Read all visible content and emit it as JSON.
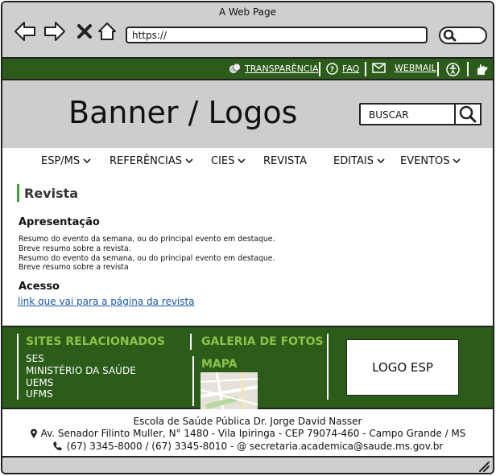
{
  "browser": {
    "title": "A Web Page",
    "url": "https://"
  },
  "utility": {
    "transparencia": "TRANSPARÊNCIA",
    "faq": "FAQ",
    "webmail": "WEBMAIL"
  },
  "banner": {
    "title": "Banner / Logos",
    "search_placeholder": "BUSCAR"
  },
  "menu": {
    "esp_ms": "ESP/MS",
    "referencias": "REFERÊNCIAS",
    "cies": "CIES",
    "revista": "REVISTA",
    "editais": "EDITAIS",
    "eventos": "EVENTOS"
  },
  "content": {
    "section_title": "Revista",
    "apresentacao_heading": "Apresentação",
    "paragraph_lines": [
      "Resumo do evento da semana, ou do principal evento em destaque.",
      "Breve resumo sobre a revista.",
      "Resumo do evento da semana, ou do principal evento em destaque.",
      "Breve resumo sobre a revista"
    ],
    "acesso_heading": "Acesso",
    "acesso_link": "link que vai para a página da revista"
  },
  "footer": {
    "sites_heading": "SITES RELACIONADOS",
    "sites": [
      "SES",
      "MINISTÉRIO DA SAÚDE",
      "UEMS",
      "UFMS"
    ],
    "galeria_heading": "GALERIA DE FOTOS",
    "mapa_heading": "MAPA",
    "logo": "LOGO ESP"
  },
  "address": {
    "name": "Escola de Saúde Pública Dr. Jorge David Nasser",
    "street": "Av. Senador Filinto Muller, N° 1480 - Vila Ipiringa - CEP 79074-460 - Campo Grande / MS",
    "contact": "(67) 3345-8000 / (67) 3345-8010  - @ secretaria.academica@saude.ms.gov.br"
  },
  "colors": {
    "green_dark": "#2b5c1a",
    "green_light": "#8bc34a",
    "link_blue": "#1a57a8"
  }
}
